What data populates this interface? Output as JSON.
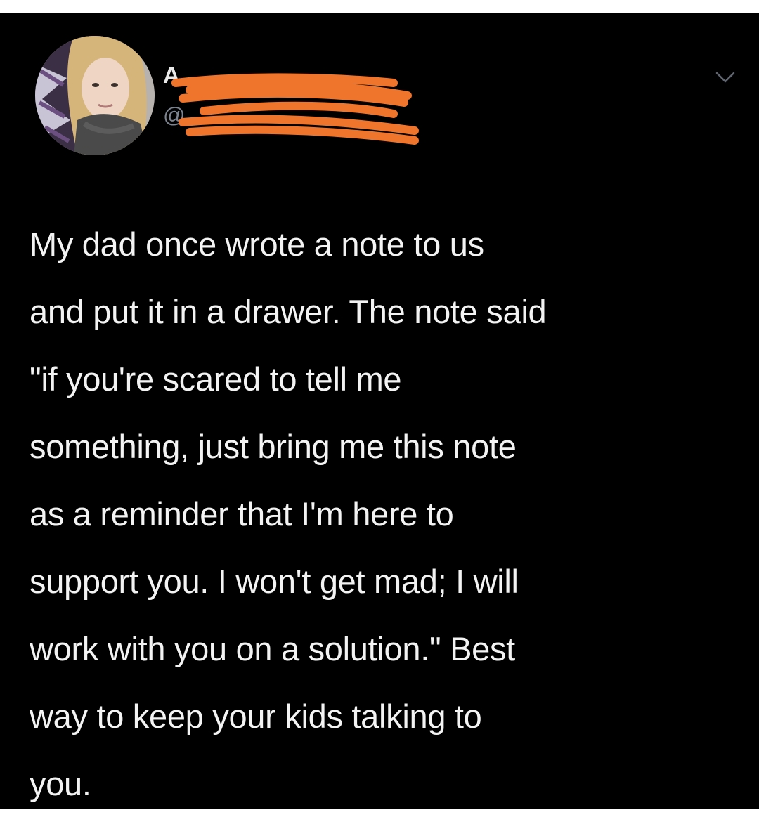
{
  "tweet": {
    "author": {
      "name": "A",
      "handle": "@"
    },
    "body_lines": [
      "My dad once wrote a note to us",
      "and put it in a drawer. The note said",
      "\"if you're scared to tell me",
      "something, just bring me this note",
      "as a reminder that I'm here to",
      "support you. I won't get mad; I will",
      "work with you on a solution.\" Best",
      "way to keep your kids talking to",
      "you."
    ],
    "menu_icon": "chevron-down-icon"
  },
  "colors": {
    "background": "#000000",
    "text": "#f3f3f3",
    "handle": "#7d8590",
    "redaction": "#f0752c"
  }
}
